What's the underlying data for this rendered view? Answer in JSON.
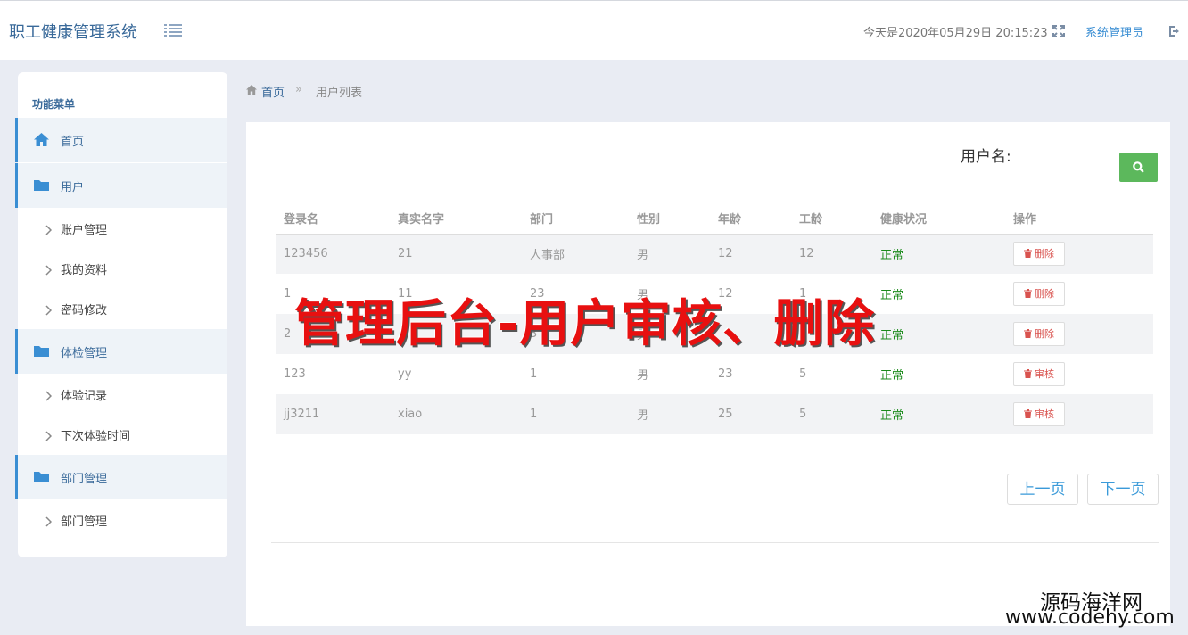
{
  "header": {
    "app_title": "职工健康管理系统",
    "datetime": "今天是2020年05月29日 20:15:23",
    "admin_name": "系统管理员"
  },
  "sidebar": {
    "heading": "功能菜单",
    "items": [
      {
        "label": "首页",
        "icon": "home-icon"
      },
      {
        "label": "用户",
        "icon": "folder-icon"
      },
      {
        "label": "账户管理",
        "icon": "chevron-right-icon"
      },
      {
        "label": "我的资料",
        "icon": "chevron-right-icon"
      },
      {
        "label": "密码修改",
        "icon": "chevron-right-icon"
      },
      {
        "label": "体检管理",
        "icon": "folder-icon"
      },
      {
        "label": "体验记录",
        "icon": "chevron-right-icon"
      },
      {
        "label": "下次体验时间",
        "icon": "chevron-right-icon"
      },
      {
        "label": "部门管理",
        "icon": "folder-icon"
      },
      {
        "label": "部门管理",
        "icon": "chevron-right-icon"
      }
    ]
  },
  "breadcrumb": {
    "home": "首页",
    "separator": "»",
    "current": "用户列表"
  },
  "search": {
    "label": "用户名:",
    "value": "",
    "placeholder": ""
  },
  "table": {
    "columns": [
      "登录名",
      "真实名字",
      "部门",
      "性别",
      "年龄",
      "工龄",
      "健康状况",
      "操作"
    ],
    "rows": [
      {
        "login": "123456",
        "realname": "21",
        "dept": "人事部",
        "gender": "男",
        "age": "12",
        "seniority": "12",
        "health": "正常",
        "action": "删除"
      },
      {
        "login": "1",
        "realname": "11",
        "dept": "23",
        "gender": "男",
        "age": "12",
        "seniority": "1",
        "health": "正常",
        "action": "删除"
      },
      {
        "login": "2",
        "realname": "",
        "dept": "3",
        "gender": "男",
        "age": "",
        "seniority": "",
        "health": "正常",
        "action": "删除"
      },
      {
        "login": "123",
        "realname": "yy",
        "dept": "1",
        "gender": "男",
        "age": "23",
        "seniority": "5",
        "health": "正常",
        "action": "审核"
      },
      {
        "login": "jj3211",
        "realname": "xiao",
        "dept": "1",
        "gender": "男",
        "age": "25",
        "seniority": "5",
        "health": "正常",
        "action": "审核"
      }
    ]
  },
  "pagination": {
    "prev": "上一页",
    "next": "下一页"
  },
  "overlay": {
    "caption": "管理后台-用户审核、删除",
    "watermark_cn": "源码海洋网",
    "watermark_url": "www.codehy.com"
  },
  "colors": {
    "accent": "#3a8ed3",
    "title": "#3a6a9a",
    "search_button": "#5cb85c",
    "danger": "#d9534f",
    "health_ok": "#1a8a1a",
    "overlay_caption": "#e81010"
  }
}
